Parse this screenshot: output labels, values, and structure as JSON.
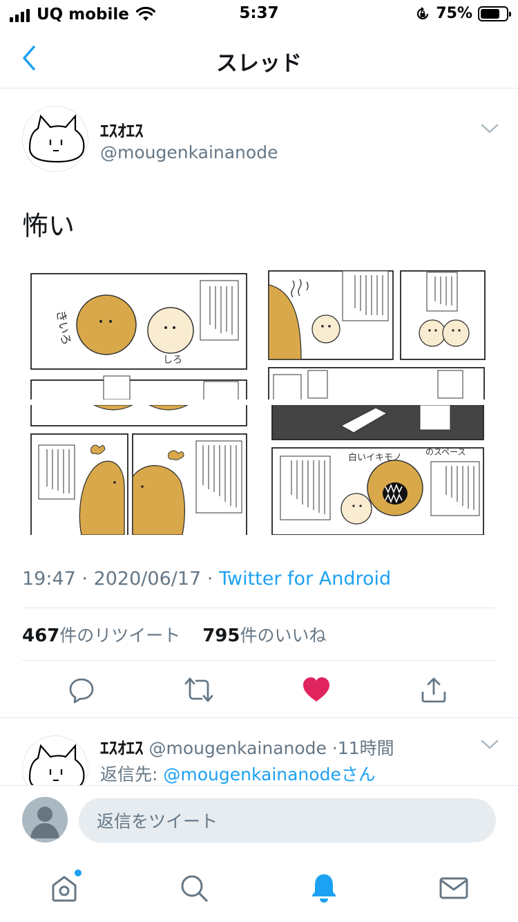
{
  "status_bar": {
    "carrier": "UQ mobile",
    "time": "5:37",
    "battery_percent": "75%",
    "battery_level": 0.75
  },
  "nav": {
    "title": "スレッド"
  },
  "tweet": {
    "author_name": "ｴｽｵｴｽ",
    "author_handle": "@mougenkainanode",
    "text": "怖い",
    "time": "19:47",
    "date": "2020/06/17",
    "source": "Twitter for Android",
    "retweet_count": "467",
    "retweet_label": "件のリツイート",
    "like_count": "795",
    "like_label": "件のいいね",
    "liked": true
  },
  "reply_preview": {
    "author_name": "ｴｽｵｴｽ",
    "author_handle": "@mougenkainanode",
    "time_ago": "11時間",
    "reply_to_prefix": "返信先: ",
    "reply_to_handle": "@mougenkainanode",
    "reply_to_suffix": "さん"
  },
  "reply_bar": {
    "placeholder": "返信をツイート"
  },
  "colors": {
    "accent": "#1da1f2",
    "like": "#e0245e",
    "secondary_text": "#657786",
    "divider": "#e1e8ed",
    "comic_orange": "#d8a84a",
    "comic_cream": "#f9ecd1"
  }
}
